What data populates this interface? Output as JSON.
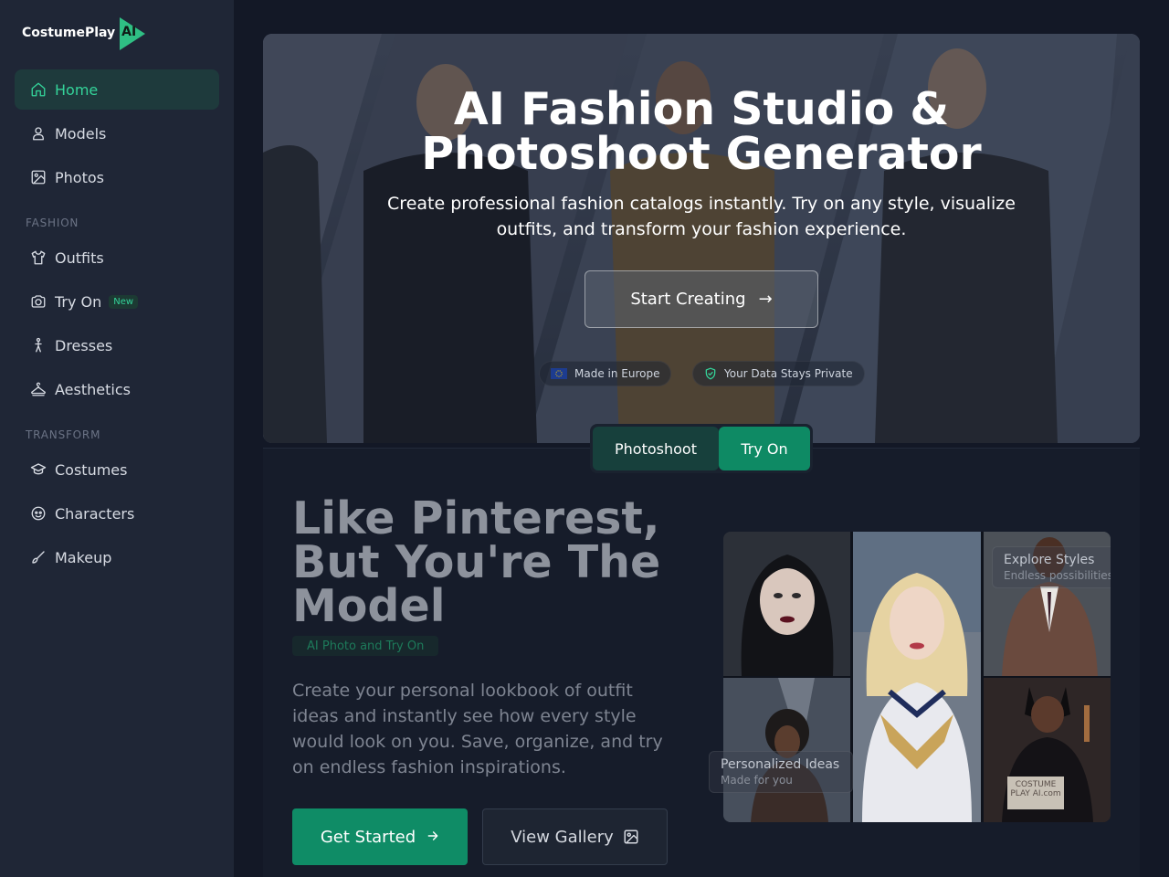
{
  "brand": {
    "name": "CostumePlay",
    "mark": "AI",
    "accent": "#34d399"
  },
  "sidebar": {
    "items": [
      {
        "label": "Home",
        "icon": "home-icon",
        "active": true
      },
      {
        "label": "Models",
        "icon": "user-icon"
      },
      {
        "label": "Photos",
        "icon": "image-icon"
      }
    ],
    "fashion_label": "FASHION",
    "fashion_items": [
      {
        "label": "Outfits",
        "icon": "shirt-icon"
      },
      {
        "label": "Try On",
        "icon": "camera-icon",
        "badge": "New"
      },
      {
        "label": "Dresses",
        "icon": "dress-icon"
      },
      {
        "label": "Aesthetics",
        "icon": "hanger-icon"
      }
    ],
    "transform_label": "TRANSFORM",
    "transform_items": [
      {
        "label": "Costumes",
        "icon": "graduation-cap-icon"
      },
      {
        "label": "Characters",
        "icon": "mask-icon"
      },
      {
        "label": "Makeup",
        "icon": "brush-icon"
      }
    ]
  },
  "hero": {
    "title_line1": "AI Fashion Studio &",
    "title_line2": "Photoshoot Generator",
    "subtitle": "Create professional fashion catalogs instantly. Try on any style, visualize outfits, and transform your fashion experience.",
    "cta": "Start Creating",
    "cta_arrow": "→",
    "pill_europe": "Made in Europe",
    "pill_private": "Your Data Stays Private"
  },
  "tabs": {
    "photoshoot": "Photoshoot",
    "try_on": "Try On"
  },
  "feature": {
    "title": "Like Pinterest, But You're The Model",
    "badge": "AI Photo and Try On",
    "description": "Create your personal lookbook of outfit ideas and instantly see how every style would look on you. Save, organize, and try on endless fashion inspirations.",
    "get_started": "Get Started",
    "view_gallery": "View Gallery"
  },
  "gallery": {
    "card_top_title": "Explore Styles",
    "card_top_sub": "Endless possibilities",
    "card_bottom_title": "Personalized Ideas",
    "card_bottom_sub": "Made for you",
    "sign_text": "COSTUME PLAY AI.com"
  }
}
